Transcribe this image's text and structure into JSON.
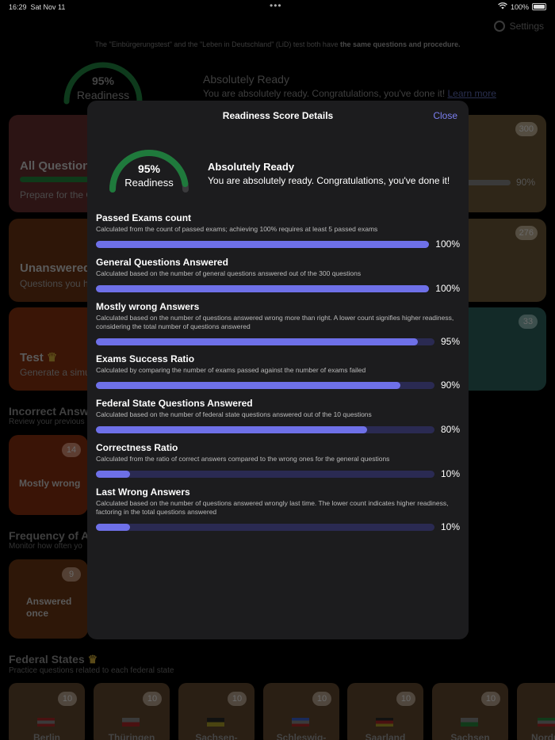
{
  "status_bar": {
    "time": "16:29",
    "date": "Sat Nov 11",
    "battery": "100%"
  },
  "background": {
    "settings_label": "Settings",
    "info_note_prefix": "The \"Einbürgerungstest\" and the \"Leben in Deutschland\" (LiD) test both have ",
    "info_note_bold": "the same questions and procedure.",
    "gauge": {
      "percent": "95%",
      "label": "Readiness"
    },
    "ready_title": "Absolutely Ready",
    "ready_text": "You are absolutely ready. Congratulations, you've done it!",
    "learn_more": "Learn more",
    "tiles": {
      "all_questions": {
        "title": "All Question",
        "subtitle": "Prepare for the C",
        "badge": "300",
        "percent": "90%"
      },
      "unanswered": {
        "title": "Unanswered",
        "subtitle": "Questions you ha",
        "badge": "276"
      },
      "test": {
        "title": "Test",
        "subtitle": "Generate a simu",
        "badge": "33"
      }
    },
    "incorrect_section": {
      "title": "Incorrect Answe",
      "subtitle": "Review your previous"
    },
    "mostly_wrong_tile": {
      "label": "Mostly wrong",
      "badge": "14"
    },
    "frequency_section": {
      "title": "Frequency of Ar",
      "subtitle": "Monitor how often yo"
    },
    "answered_once_tile": {
      "label_line1": "Answered",
      "label_line2": "once",
      "badge": "9"
    },
    "federal_section": {
      "title": "Federal States",
      "subtitle": "Practice questions related to each federal state"
    },
    "federal_states": [
      {
        "name": "Berlin",
        "badge": "10"
      },
      {
        "name": "Thüringen",
        "badge": "10"
      },
      {
        "name": "Sachsen-",
        "badge": "10"
      },
      {
        "name": "Schleswig-",
        "badge": "10"
      },
      {
        "name": "Saarland",
        "badge": "10"
      },
      {
        "name": "Sachsen",
        "badge": "10"
      },
      {
        "name": "Nordr",
        "badge": ""
      }
    ]
  },
  "modal": {
    "title": "Readiness Score Details",
    "close_label": "Close",
    "gauge": {
      "percent": "95%",
      "label": "Readiness",
      "value": 0.95
    },
    "ready_title": "Absolutely Ready",
    "ready_text": "You are absolutely ready. Congratulations, you've done it!",
    "metrics": [
      {
        "title": "Passed Exams count",
        "description": "Calculated from the count of passed exams; achieving 100% requires at least 5 passed exams",
        "value": "100%",
        "fill": 1.0
      },
      {
        "title": "General Questions Answered",
        "description": "Calculated based on the number of general questions answered out of the 300 questions",
        "value": "100%",
        "fill": 1.0
      },
      {
        "title": "Mostly wrong Answers",
        "description": "Calculated based on the number of questions answered wrong more than right. A lower count signifies higher readiness, considering the total number of questions answered",
        "value": "95%",
        "fill": 0.95
      },
      {
        "title": "Exams Success Ratio",
        "description": "Calculated by comparing the number of exams passed against the number of exams failed",
        "value": "90%",
        "fill": 0.9
      },
      {
        "title": "Federal State Questions Answered",
        "description": "Calculated based on the number of federal state questions answered out of the 10 questions",
        "value": "80%",
        "fill": 0.8
      },
      {
        "title": "Correctness Ratio",
        "description": "Calculated from the ratio of correct answers compared to the wrong ones for the general questions",
        "value": "10%",
        "fill": 0.1
      },
      {
        "title": "Last Wrong Answers",
        "description": "Calculated based on the number of questions answered wrongly last time. The lower count indicates higher readiness, factoring in the total questions answered",
        "value": "10%",
        "fill": 0.1
      }
    ]
  },
  "colors": {
    "accent": "#6e70e8",
    "track": "#2a2a52",
    "gauge_green": "#1f7a3c",
    "link": "#7b7ff0"
  }
}
